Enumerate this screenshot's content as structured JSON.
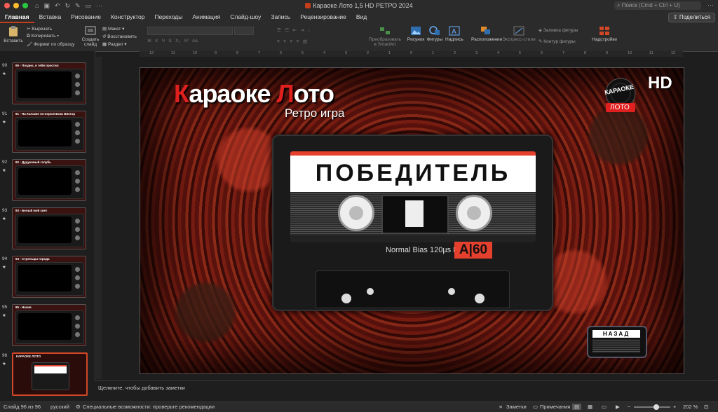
{
  "window": {
    "title": "Караоке Лото 1,5 HD РЕТРО 2024",
    "search_placeholder": "Поиск (Cmd + Ctrl + U)",
    "quick_access_more": "···"
  },
  "tabs": [
    {
      "label": "Главная",
      "active": true
    },
    {
      "label": "Вставка"
    },
    {
      "label": "Рисование"
    },
    {
      "label": "Конструктор"
    },
    {
      "label": "Переходы"
    },
    {
      "label": "Анимация"
    },
    {
      "label": "Слайд-шоу"
    },
    {
      "label": "Запись"
    },
    {
      "label": "Рецензирование"
    },
    {
      "label": "Вид"
    }
  ],
  "share_label": "Поделиться",
  "ribbon": {
    "paste": "Вставить",
    "cut": "Вырезать",
    "copy": "Копировать",
    "format_painter": "Формат по образцу",
    "new_slide": "Создать слайд",
    "layout": "Макет",
    "reset": "Восстановить",
    "section": "Раздел",
    "smartart": "Преобразовать в SmartArt",
    "picture": "Рисунок",
    "shapes": "Фигуры",
    "textbox": "Надпись",
    "arrange": "Расположение",
    "quick_styles": "Экспресс-стили",
    "shape_fill": "Заливка фигуры",
    "shape_outline": "Контур фигуры",
    "addins": "Надстройки"
  },
  "ruler": [
    "12",
    "11",
    "10",
    "9",
    "8",
    "7",
    "6",
    "5",
    "4",
    "3",
    "2",
    "1",
    "0",
    "1",
    "2",
    "3",
    "4",
    "5",
    "6",
    "7",
    "8",
    "9",
    "10",
    "11",
    "12"
  ],
  "thumbnails": [
    {
      "num": "90",
      "star": "★",
      "caption": "90 - Поздно, я тебя простил"
    },
    {
      "num": "91",
      "star": "★",
      "caption": "91 - На Колыме по-королевски Виктор"
    },
    {
      "num": "92",
      "star": "★",
      "caption": "92 - Дудуковый голубь"
    },
    {
      "num": "93",
      "star": "★",
      "caption": "93 - Белый мой свет"
    },
    {
      "num": "94",
      "star": "★",
      "caption": "94 - Стрельцы города"
    },
    {
      "num": "95",
      "star": "★",
      "caption": "95 - Нахия"
    },
    {
      "num": "96",
      "star": "★",
      "caption": "КАРАОКЕ ЛОТО",
      "selected": true
    }
  ],
  "slide": {
    "title_first": "К",
    "title_rest": "араоке ",
    "title_l": "Л",
    "title_end": "ото",
    "subtitle": "Ретро игра",
    "hd": "HD",
    "logo_top": "КАРАОКЕ",
    "logo_bottom": "ЛОТО",
    "winner": "ПОБЕДИТЕЛЬ",
    "bias": "Normal Bias 120µs EQ",
    "side": "A|60",
    "back": "НАЗАД"
  },
  "notes_placeholder": "Щелкните, чтобы добавить заметки",
  "status": {
    "slide_of": "Слайд 96 из 96",
    "language": "русский",
    "accessibility": "Специальные возможности: проверьте рекомендации",
    "notes": "Заметки",
    "comments": "Примечания",
    "zoom": "202 %",
    "zoom_level": 0.62
  },
  "colors": {
    "accent": "#c43e1c",
    "label_red": "#e5402d",
    "title_red": "#e01f1f"
  }
}
